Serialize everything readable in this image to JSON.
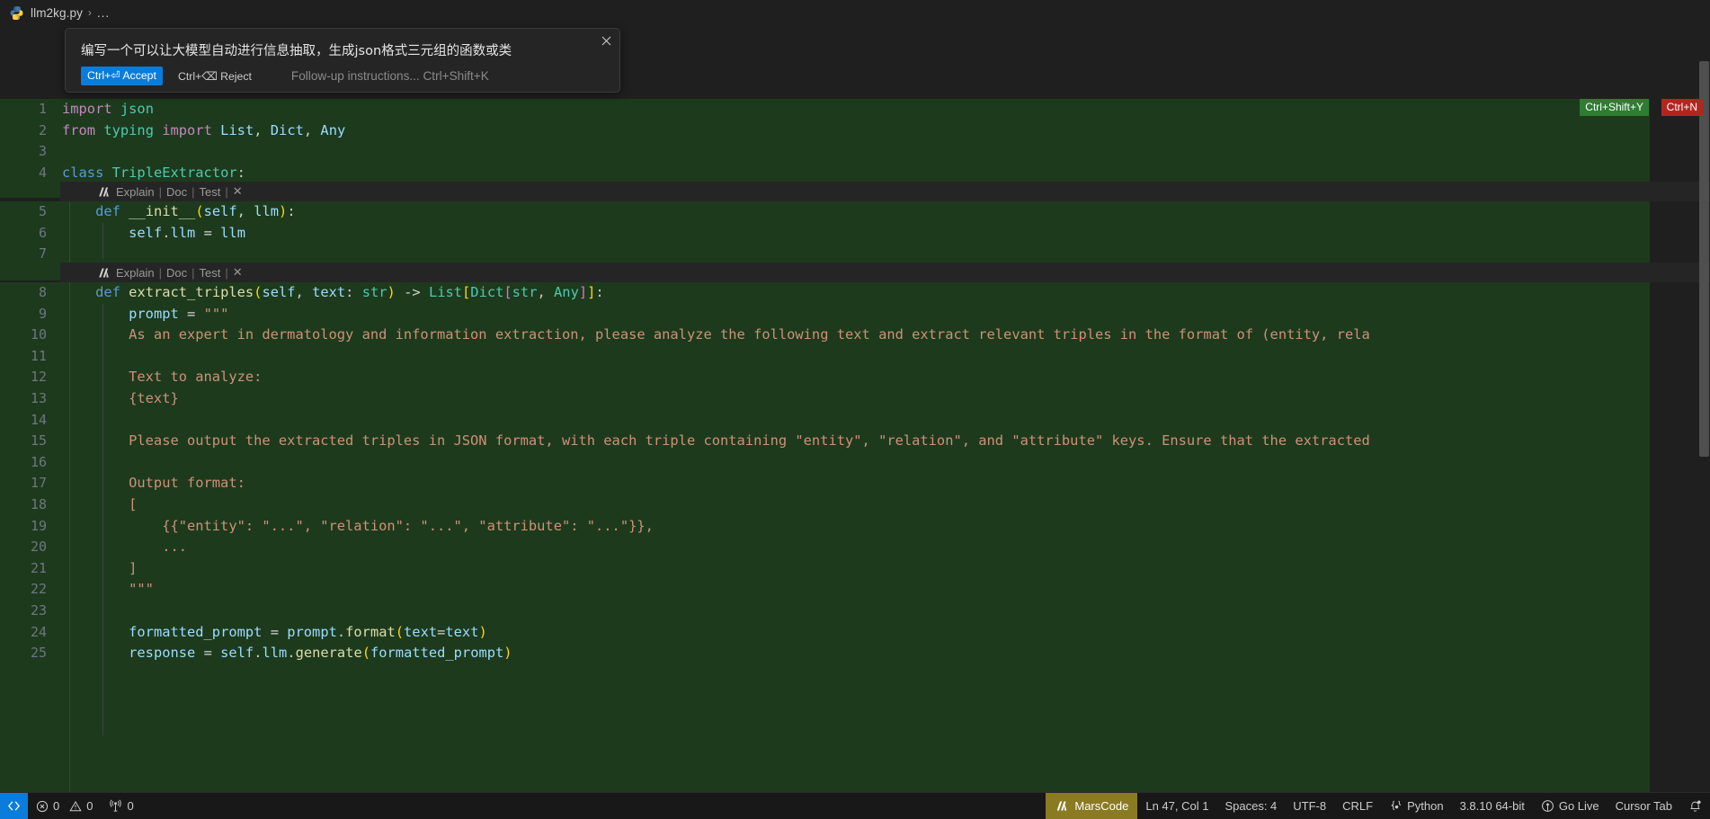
{
  "breadcrumb": {
    "file_icon": "python-file-icon",
    "file": "llm2kg.py",
    "separator": "›",
    "more": "..."
  },
  "inline_chat": {
    "prompt": "编写一个可以让大模型自动进行信息抽取，生成json格式三元组的函数或类",
    "accept_label": "Ctrl+⏎ Accept",
    "reject_label": "Ctrl+⌫ Reject",
    "followup_label": "Follow-up instructions... Ctrl+Shift+K",
    "close_icon": "close-icon",
    "accept_bg": "#0a7cdb"
  },
  "keybinding_badges": [
    {
      "label": "Ctrl+Shift+Y",
      "color": "#2d7d32",
      "name": "accept-all-badge"
    },
    {
      "label": "Ctrl+N",
      "color": "#b3261e",
      "name": "next-change-badge"
    }
  ],
  "codelens": {
    "icon": "marscode-icon",
    "items": [
      "Explain",
      "Doc",
      "Test"
    ],
    "separator": "|",
    "close": "✕"
  },
  "editor": {
    "line_numbers": [
      "1",
      "2",
      "3",
      "4",
      "5",
      "6",
      "7",
      "8",
      "9",
      "10",
      "11",
      "12",
      "13",
      "14",
      "15",
      "16",
      "17",
      "18",
      "19",
      "20",
      "21",
      "22",
      "23",
      "24",
      "25"
    ],
    "code": [
      "import json",
      "from typing import List, Dict, Any",
      "",
      "class TripleExtractor:",
      "    def __init__(self, llm):",
      "        self.llm = llm",
      "",
      "    def extract_triples(self, text: str) -> List[Dict[str, Any]]:",
      "        prompt = \"\"\"",
      "        As an expert in dermatology and information extraction, please analyze the following text and extract relevant triples in the format of (entity, rela",
      "",
      "        Text to analyze:",
      "        {text}",
      "",
      "        Please output the extracted triples in JSON format, with each triple containing \"entity\", \"relation\", and \"attribute\" keys. Ensure that the extracted",
      "",
      "        Output format:",
      "        [",
      "            {{\"entity\": \"...\", \"relation\": \"...\", \"attribute\": \"...\"}},",
      "            ...",
      "        ]",
      "        \"\"\"",
      "",
      "        formatted_prompt = prompt.format(text=text)",
      "        response = self.llm.generate(formatted_prompt)"
    ]
  },
  "statusbar": {
    "remote_icon": "remote-window-icon",
    "errors_icon": "error-icon",
    "errors": "0",
    "warnings_icon": "warning-icon",
    "warnings": "0",
    "ports_icon": "radio-tower-icon",
    "ports": "0",
    "marscode_icon": "marscode-icon",
    "marscode": "MarsCode",
    "marscode_bg": "#8a7a22",
    "cursor_position": "Ln 47, Col 1",
    "indentation": "Spaces: 4",
    "encoding": "UTF-8",
    "eol": "CRLF",
    "language_icon": "python-brackets-icon",
    "language": "Python",
    "interpreter": "3.8.10 64-bit",
    "golive_icon": "broadcast-icon",
    "golive": "Go Live",
    "cursor_tab": "Cursor Tab",
    "bell_icon": "bell-dot-icon"
  }
}
